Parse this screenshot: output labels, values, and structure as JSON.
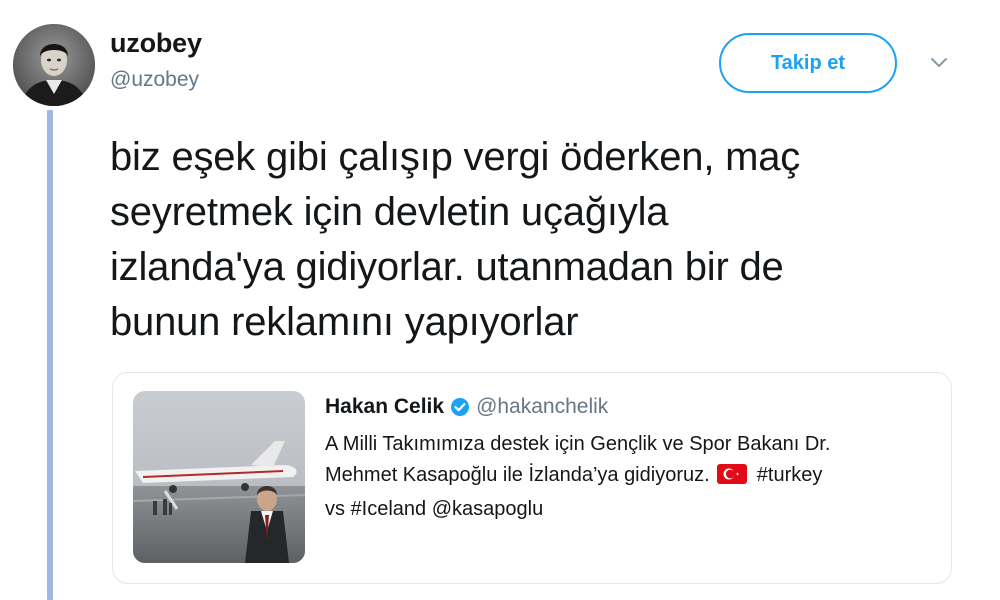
{
  "author": {
    "display_name": "uzobey",
    "handle": "@uzobey"
  },
  "follow_button": {
    "label": "Takip et"
  },
  "icons": {
    "caret": "chevron-down-icon",
    "verified": "verified-badge-icon",
    "flag": "turkey-flag-icon"
  },
  "colors": {
    "accent": "#1da1f2",
    "thread_line": "#9fb7e1",
    "muted_text": "#657786",
    "flag_red": "#e30a17"
  },
  "tweet": {
    "text_lines": [
      "biz eşek gibi çalışıp vergi öderken, maç",
      "seyretmek için devletin uçağıyla",
      "izlanda'ya gidiyorlar. utanmadan bir de",
      "bunun reklamını yapıyorlar"
    ]
  },
  "quoted_tweet": {
    "display_name": "Hakan Celik",
    "handle": "@hakanchelik",
    "text": {
      "line1": "A Milli Takımımıza destek için Gençlik ve Spor Bakanı Dr.",
      "line2_before_flag": "Mehmet Kasapoğlu ile  İzlanda’ya gidiyoruz.",
      "line2_after_flag": "#turkey",
      "line3": "vs #Iceland @kasapoglu"
    }
  }
}
